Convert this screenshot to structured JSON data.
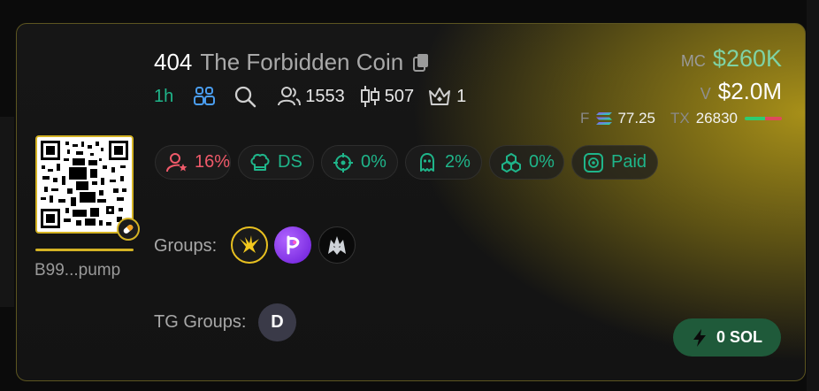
{
  "token": {
    "ticker": "404",
    "name": "The Forbidden Coin",
    "address_short": "B99...pump"
  },
  "stats": {
    "timeframe": "1h",
    "holders": "1553",
    "candles": "507",
    "top_holders": "1"
  },
  "metrics": {
    "mc_label": "MC",
    "mc_value": "$260K",
    "v_label": "V",
    "v_value": "$2.0M",
    "f_label": "F",
    "f_value": "77.25",
    "tx_label": "TX",
    "tx_value": "26830",
    "tx_buy_fraction": 0.55
  },
  "badges": [
    {
      "icon": "user-star-icon",
      "value": "16%",
      "color": "#f05a6a"
    },
    {
      "icon": "chef-hat-icon",
      "value": "DS",
      "color": "#1fb58a"
    },
    {
      "icon": "crosshair-icon",
      "value": "0%",
      "color": "#1fb58a"
    },
    {
      "icon": "ghost-icon",
      "value": "2%",
      "color": "#1fb58a"
    },
    {
      "icon": "cubes-icon",
      "value": "0%",
      "color": "#1fb58a"
    },
    {
      "icon": "dex-paid-icon",
      "value": "Paid",
      "color": "#1fb58a"
    }
  ],
  "groups": {
    "label": "Groups:",
    "avatars": [
      "bird-emblem-icon",
      "purple-logo-icon",
      "wolf-icon"
    ]
  },
  "tg_groups": {
    "label": "TG Groups:",
    "avatar_letter": "D"
  },
  "buy_button": {
    "label": "0 SOL",
    "icon": "lightning-icon"
  },
  "colors": {
    "accent_gold": "#d4b324",
    "green": "#1fb58a",
    "red": "#f05a6a",
    "mc_green": "#7fd3a5",
    "buy_bg": "#1f5a3a"
  }
}
